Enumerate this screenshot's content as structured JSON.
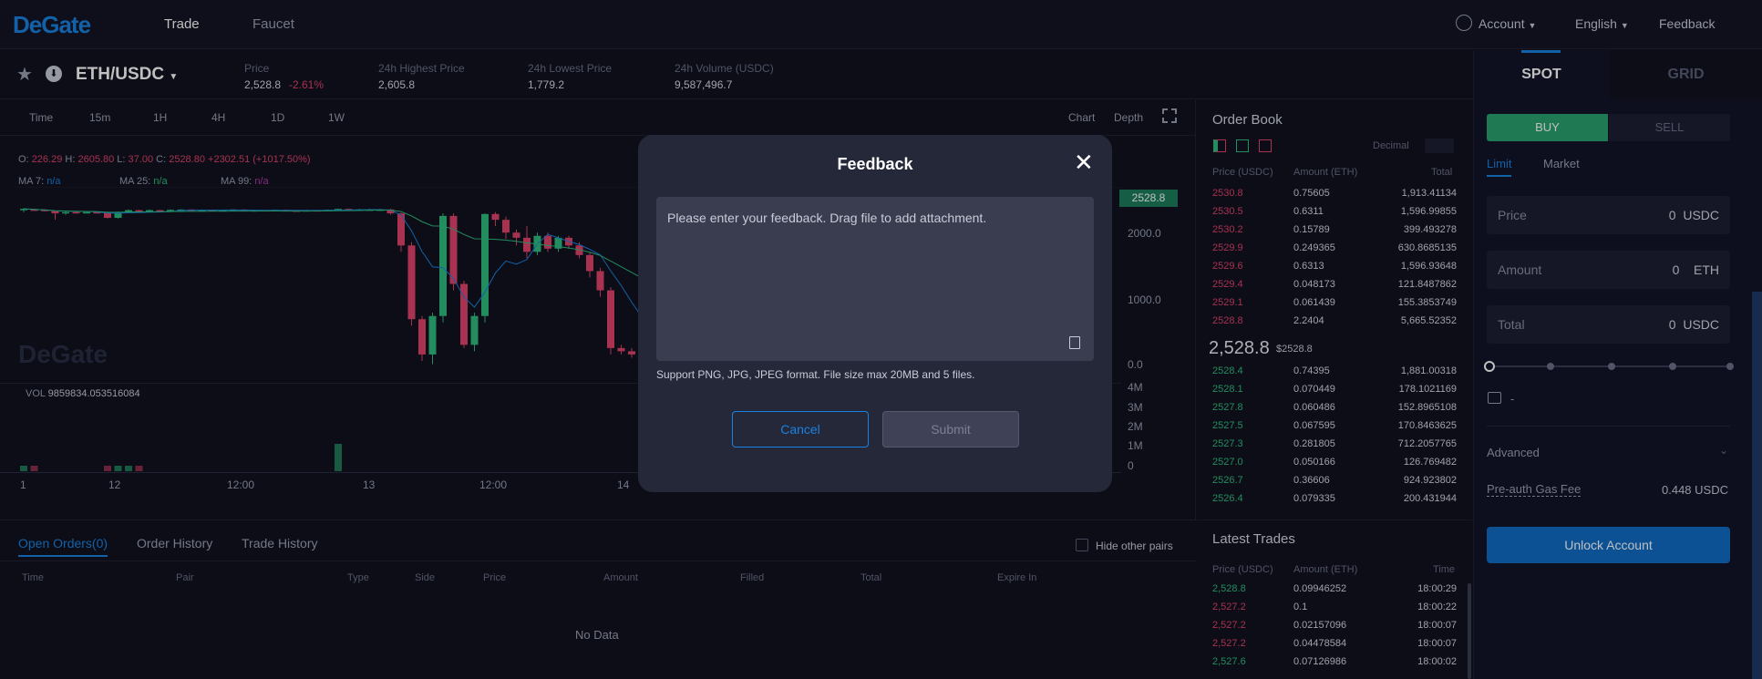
{
  "brand": "DeGate",
  "nav": {
    "trade": "Trade",
    "faucet": "Faucet",
    "account": "Account",
    "language": "English",
    "feedback": "Feedback"
  },
  "pair": {
    "name": "ETH/USDC",
    "price_label": "Price",
    "price": "2,528.8",
    "change": "-2.61%",
    "high_label": "24h Highest Price",
    "high": "2,605.8",
    "low_label": "24h Lowest Price",
    "low": "1,779.2",
    "vol_label": "24h Volume (USDC)",
    "vol": "9,587,496.7"
  },
  "chart": {
    "timeframes": [
      "Time",
      "15m",
      "1H",
      "4H",
      "1D",
      "1W"
    ],
    "active_tf": "1H",
    "view_chart": "Chart",
    "view_depth": "Depth",
    "ohlc": {
      "o_label": "O:",
      "o": "226.29",
      "h_label": "H:",
      "h": "2605.80",
      "l_label": "L:",
      "l": "37.00",
      "c_label": "C:",
      "c": "2528.80 +2302.51 (+1017.50%)"
    },
    "ma": {
      "ma7_label": "MA 7:",
      "ma7": "n/a",
      "ma25_label": "MA 25:",
      "ma25": "n/a",
      "ma99_label": "MA 99:",
      "ma99": "n/a"
    },
    "watermark": "DeGate",
    "current_price_tag": "2528.8",
    "y_ticks": [
      "2000.0",
      "1000.0",
      "0.0"
    ],
    "vol_label": "VOL",
    "vol_value": "9859834.053516084",
    "vol_ticks": [
      "4M",
      "3M",
      "2M",
      "1M",
      "0"
    ],
    "x_ticks": [
      "1",
      "12",
      "12:00",
      "13",
      "12:00",
      "14"
    ]
  },
  "chart_data": {
    "type": "candlestick",
    "title": "",
    "ylim": [
      0,
      2700
    ],
    "candles": [
      [
        2450,
        2470,
        2420,
        2480
      ],
      [
        2460,
        2455,
        2440,
        2470
      ],
      [
        2455,
        2440,
        2430,
        2460
      ],
      [
        2440,
        2400,
        2300,
        2445
      ],
      [
        2400,
        2420,
        2380,
        2430
      ],
      [
        2420,
        2410,
        2400,
        2430
      ],
      [
        2410,
        2420,
        2400,
        2425
      ],
      [
        2420,
        2415,
        2405,
        2425
      ],
      [
        2415,
        2330,
        2320,
        2425
      ],
      [
        2330,
        2420,
        2320,
        2430
      ],
      [
        2420,
        2450,
        2410,
        2460
      ],
      [
        2450,
        2440,
        2430,
        2455
      ],
      [
        2440,
        2450,
        2435,
        2460
      ],
      [
        2450,
        2445,
        2440,
        2455
      ],
      [
        2445,
        2455,
        2440,
        2460
      ],
      [
        2455,
        2460,
        2445,
        2465
      ],
      [
        2460,
        2450,
        2440,
        2465
      ],
      [
        2450,
        2455,
        2445,
        2460
      ],
      [
        2455,
        2445,
        2440,
        2460
      ],
      [
        2445,
        2450,
        2440,
        2455
      ],
      [
        2450,
        2460,
        2445,
        2465
      ],
      [
        2460,
        2440,
        2430,
        2465
      ],
      [
        2440,
        2450,
        2430,
        2455
      ],
      [
        2450,
        2440,
        2430,
        2455
      ],
      [
        2440,
        2455,
        2435,
        2460
      ],
      [
        2455,
        2445,
        2440,
        2460
      ],
      [
        2445,
        2440,
        2430,
        2450
      ],
      [
        2440,
        2450,
        2435,
        2455
      ],
      [
        2450,
        2448,
        2440,
        2455
      ],
      [
        2448,
        2455,
        2440,
        2460
      ],
      [
        2455,
        2470,
        2450,
        2475
      ],
      [
        2470,
        2460,
        2455,
        2475
      ],
      [
        2460,
        2460,
        2450,
        2470
      ],
      [
        2460,
        2460,
        2450,
        2470
      ],
      [
        2460,
        2460,
        2455,
        2470
      ],
      [
        2460,
        2400,
        2380,
        2470
      ],
      [
        2400,
        1900,
        1800,
        2410
      ],
      [
        1900,
        750,
        650,
        1950
      ],
      [
        750,
        200,
        100,
        800
      ],
      [
        200,
        800,
        50,
        850
      ],
      [
        800,
        2360,
        700,
        2400
      ],
      [
        2360,
        1300,
        1200,
        2400
      ],
      [
        1300,
        350,
        300,
        1350
      ],
      [
        350,
        800,
        250,
        850
      ],
      [
        800,
        2390,
        700,
        2400
      ],
      [
        2390,
        2300,
        2200,
        2420
      ],
      [
        2300,
        2100,
        2000,
        2350
      ],
      [
        2100,
        2020,
        1900,
        2150
      ],
      [
        2020,
        1800,
        1700,
        2200
      ],
      [
        1800,
        2050,
        1750,
        2100
      ],
      [
        2050,
        1850,
        1800,
        2100
      ],
      [
        1850,
        2020,
        1800,
        2050
      ],
      [
        2020,
        1900,
        1850,
        2050
      ],
      [
        1900,
        1750,
        1700,
        1950
      ],
      [
        1750,
        1500,
        1400,
        1800
      ],
      [
        1500,
        1200,
        1100,
        1550
      ],
      [
        1200,
        300,
        200,
        1250
      ],
      [
        300,
        250,
        200,
        350
      ],
      [
        250,
        200,
        150,
        300
      ],
      [
        200,
        250,
        150,
        300
      ],
      [
        250,
        250,
        200,
        300
      ],
      [
        250,
        300,
        200,
        350
      ],
      [
        300,
        800,
        250,
        1350
      ],
      [
        800,
        300,
        250,
        850
      ]
    ],
    "volumes": [
      0.1,
      0.1,
      0,
      0,
      0,
      0,
      0,
      0,
      0.1,
      0.1,
      0.1,
      0.1,
      0,
      0,
      0,
      0,
      0,
      0,
      0,
      0,
      0,
      0,
      0,
      0,
      0,
      0,
      0,
      0,
      0,
      0,
      0.5,
      0,
      0,
      0,
      0,
      0,
      0,
      0,
      0,
      0,
      0,
      0,
      0,
      0,
      0,
      0,
      0,
      0,
      0,
      0,
      0,
      0,
      0,
      0,
      0,
      0,
      0,
      0,
      0,
      0,
      0,
      0,
      0,
      0
    ]
  },
  "orderbook": {
    "title": "Order Book",
    "decimal": "Decimal",
    "headers": [
      "Price (USDC)",
      "Amount (ETH)",
      "Total"
    ],
    "asks": [
      [
        "2530.8",
        "0.75605",
        "1,913.41134"
      ],
      [
        "2530.5",
        "0.6311",
        "1,596.99855"
      ],
      [
        "2530.2",
        "0.15789",
        "399.493278"
      ],
      [
        "2529.9",
        "0.249365",
        "630.8685135"
      ],
      [
        "2529.6",
        "0.6313",
        "1,596.93648"
      ],
      [
        "2529.4",
        "0.048173",
        "121.8487862"
      ],
      [
        "2529.1",
        "0.061439",
        "155.3853749"
      ],
      [
        "2528.8",
        "2.2404",
        "5,665.52352"
      ]
    ],
    "mid": "2,528.8",
    "mid_usd": "$2528.8",
    "bids": [
      [
        "2528.4",
        "0.74395",
        "1,881.00318"
      ],
      [
        "2528.1",
        "0.070449",
        "178.1021169"
      ],
      [
        "2527.8",
        "0.060486",
        "152.8965108"
      ],
      [
        "2527.5",
        "0.067595",
        "170.8463625"
      ],
      [
        "2527.3",
        "0.281805",
        "712.2057765"
      ],
      [
        "2527.0",
        "0.050166",
        "126.769482"
      ],
      [
        "2526.7",
        "0.36606",
        "924.923802"
      ],
      [
        "2526.4",
        "0.079335",
        "200.431944"
      ]
    ]
  },
  "latest": {
    "title": "Latest Trades",
    "headers": [
      "Price (USDC)",
      "Amount (ETH)",
      "Time"
    ],
    "rows": [
      [
        "2,528.8",
        "0.09946252",
        "18:00:29",
        "g"
      ],
      [
        "2,527.2",
        "0.1",
        "18:00:22",
        "r"
      ],
      [
        "2,527.2",
        "0.02157096",
        "18:00:07",
        "r"
      ],
      [
        "2,527.2",
        "0.04478584",
        "18:00:07",
        "r"
      ],
      [
        "2,527.6",
        "0.07126986",
        "18:00:02",
        "g"
      ]
    ]
  },
  "orders": {
    "tabs": [
      "Open Orders(0)",
      "Order History",
      "Trade History"
    ],
    "hide_pairs": "Hide other pairs",
    "cols": [
      "Time",
      "Pair",
      "Type",
      "Side",
      "Price",
      "Amount",
      "Filled",
      "Total",
      "Expire In"
    ],
    "empty": "No Data"
  },
  "panel": {
    "spot": "SPOT",
    "grid": "GRID",
    "buy": "BUY",
    "sell": "SELL",
    "limit": "Limit",
    "market": "Market",
    "price_ph": "Price",
    "price_val": "0",
    "price_unit": "USDC",
    "amount_ph": "Amount",
    "amount_val": "0",
    "amount_unit": "ETH",
    "total_ph": "Total",
    "total_val": "0",
    "total_unit": "USDC",
    "slider_pct": 0,
    "wallet": "-",
    "advanced": "Advanced",
    "gas_label": "Pre-auth Gas Fee",
    "gas_val": "0.448 USDC",
    "unlock": "Unlock Account"
  },
  "modal": {
    "title": "Feedback",
    "placeholder": "Please enter your feedback. Drag file to add attachment.",
    "hint": "Support PNG, JPG, JPEG format. File size max 20MB and 5 files.",
    "cancel": "Cancel",
    "submit": "Submit"
  },
  "colors": {
    "accent": "#1a82e0",
    "up": "#2fbd80",
    "down": "#e0436b",
    "buy": "#2aa36f"
  }
}
